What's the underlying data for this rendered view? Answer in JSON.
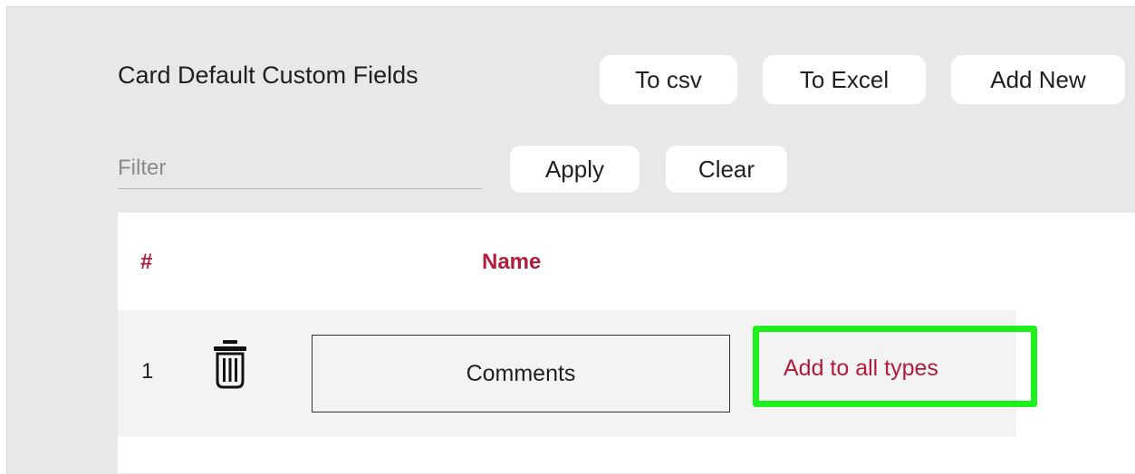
{
  "header": {
    "title": "Card Default Custom Fields",
    "to_csv_label": "To csv",
    "to_excel_label": "To Excel",
    "add_new_label": "Add New"
  },
  "filter": {
    "placeholder": "Filter",
    "value": "",
    "apply_label": "Apply",
    "clear_label": "Clear"
  },
  "table": {
    "columns": [
      "#",
      "Name"
    ],
    "rows": [
      {
        "number": "1",
        "name": "Comments",
        "action_label": "Add to all types",
        "delete_icon": "trash-icon"
      }
    ]
  },
  "colors": {
    "accent": "#b01c3c",
    "highlight": "#1ef01e",
    "background": "#e8e8e8"
  }
}
